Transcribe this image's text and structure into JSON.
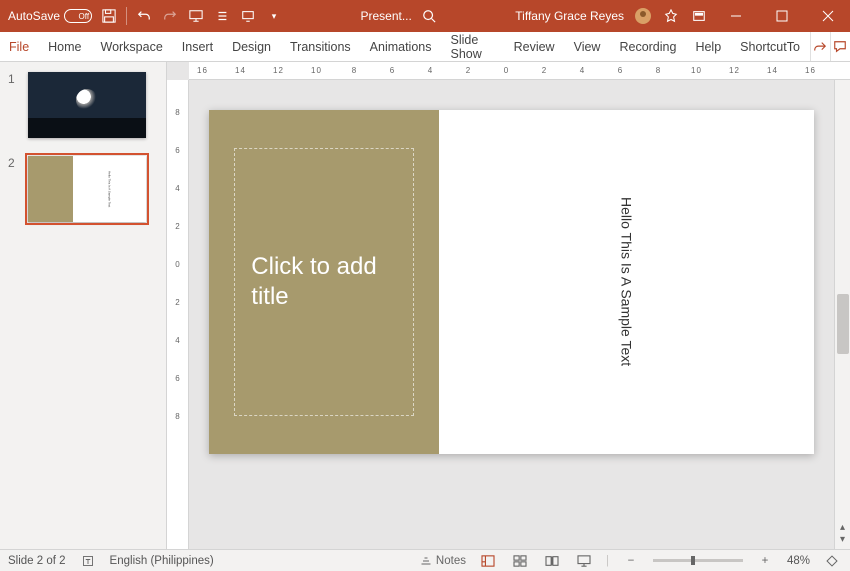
{
  "titlebar": {
    "autosave_label": "AutoSave",
    "autosave_state": "Off",
    "doc_title": "Present...",
    "user_name": "Tiffany Grace Reyes"
  },
  "ribbon": {
    "tabs": [
      "File",
      "Home",
      "Workspace",
      "Insert",
      "Design",
      "Transitions",
      "Animations",
      "Slide Show",
      "Review",
      "View",
      "Recording",
      "Help",
      "ShortcutTo"
    ]
  },
  "thumbnails": {
    "items": [
      {
        "num": "1"
      },
      {
        "num": "2"
      }
    ]
  },
  "ruler_h": [
    "16",
    "",
    "14",
    "",
    "12",
    "",
    "10",
    "",
    "8",
    "",
    "6",
    "",
    "4",
    "",
    "2",
    "",
    "0",
    "",
    "2",
    "",
    "4",
    "",
    "6",
    "",
    "8",
    "",
    "10",
    "",
    "12",
    "",
    "14",
    "",
    "16"
  ],
  "ruler_v": [
    "",
    "8",
    "",
    "6",
    "",
    "4",
    "",
    "2",
    "",
    "0",
    "",
    "2",
    "",
    "4",
    "",
    "6",
    "",
    "8",
    ""
  ],
  "slide": {
    "title_placeholder": "Click to add title",
    "sample_text": "Hello This Is A Sample Text"
  },
  "status": {
    "slide_info": "Slide 2 of 2",
    "language": "English (Philippines)",
    "notes_label": "Notes",
    "zoom_value": "48%"
  }
}
